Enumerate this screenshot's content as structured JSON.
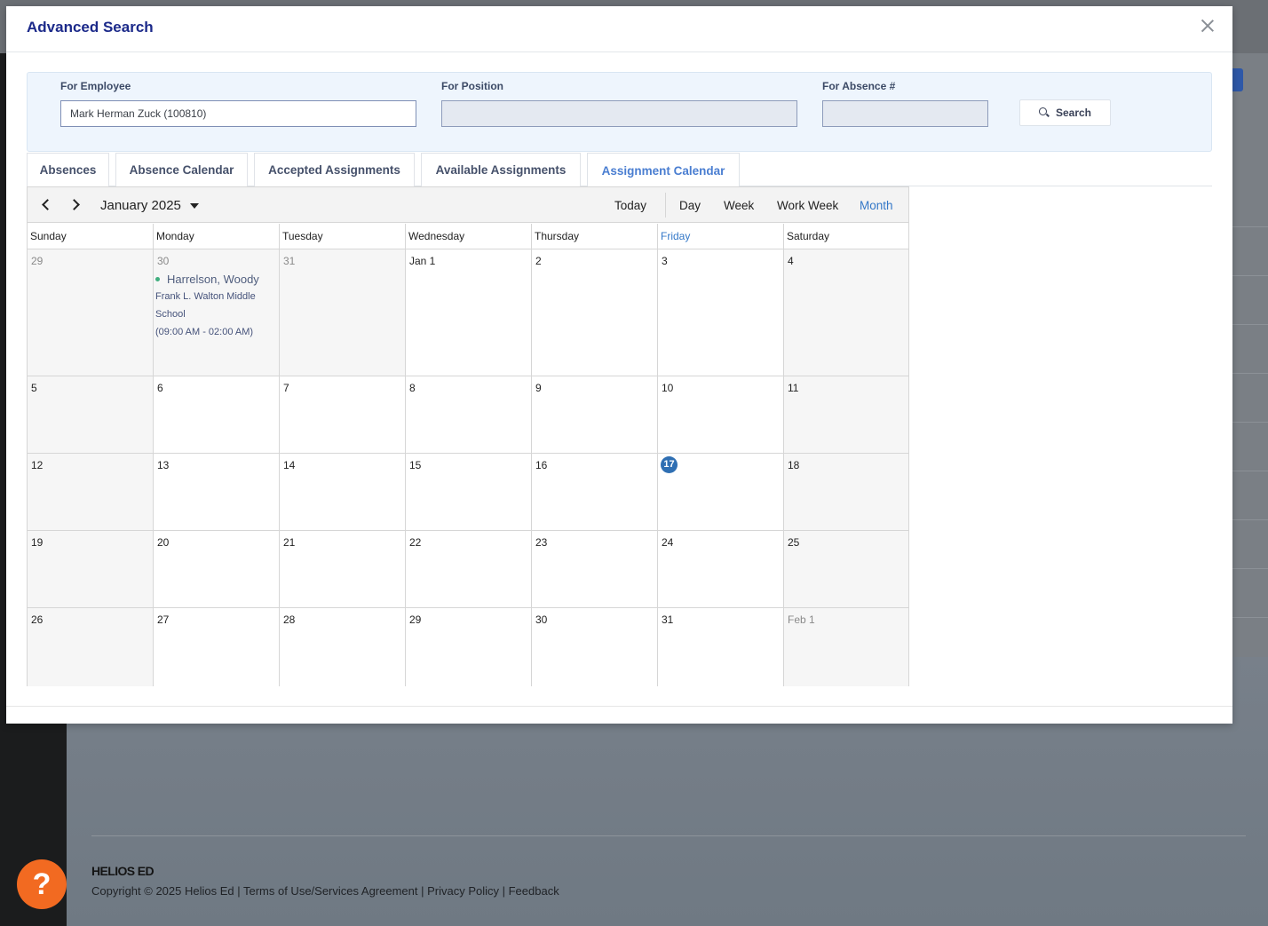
{
  "background": {
    "brand": "HELIOS ED",
    "copyright": "Copyright © 2025 Helios Ed | Terms of Use/Services Agreement | Privacy Policy | Feedback",
    "help_label": "?"
  },
  "modal": {
    "title": "Advanced Search",
    "filters": {
      "employee_label": "For Employee",
      "employee_value": "Mark Herman Zuck (100810)",
      "position_label": "For Position",
      "position_value": "",
      "absence_label": "For Absence #",
      "absence_value": "",
      "search_label": "Search"
    },
    "tabs": [
      {
        "label": "Absences"
      },
      {
        "label": "Absence Calendar"
      },
      {
        "label": "Accepted Assignments"
      },
      {
        "label": "Available Assignments"
      },
      {
        "label": "Assignment Calendar",
        "active": true
      }
    ],
    "calendar": {
      "period": "January 2025",
      "views": {
        "today": "Today",
        "day": "Day",
        "week": "Week",
        "work_week": "Work Week",
        "month": "Month"
      },
      "active_view": "Month",
      "weekdays": [
        "Sunday",
        "Monday",
        "Tuesday",
        "Wednesday",
        "Thursday",
        "Friday",
        "Saturday"
      ],
      "today_index": 5,
      "weeks": [
        [
          "29",
          "30",
          "31",
          "Jan 1",
          "2",
          "3",
          "4"
        ],
        [
          "5",
          "6",
          "7",
          "8",
          "9",
          "10",
          "11"
        ],
        [
          "12",
          "13",
          "14",
          "15",
          "16",
          "17",
          "18"
        ],
        [
          "19",
          "20",
          "21",
          "22",
          "23",
          "24",
          "25"
        ],
        [
          "26",
          "27",
          "28",
          "29",
          "30",
          "31",
          "Feb 1"
        ]
      ],
      "today_date": "17",
      "event": {
        "name": "Harrelson, Woody",
        "school_line1": "Frank L. Walton Middle",
        "school_line2": "School",
        "time": "(09:00 AM - 02:00 AM)",
        "dot_color": "#3fae7e"
      }
    }
  }
}
